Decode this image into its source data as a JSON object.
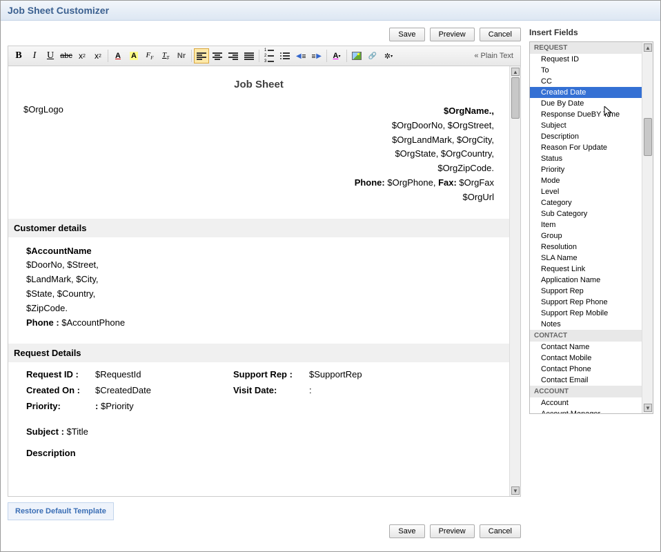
{
  "title": "Job Sheet Customizer",
  "buttons": {
    "save": "Save",
    "preview": "Preview",
    "cancel": "Cancel"
  },
  "toolbar": {
    "bold": "B",
    "italic": "I",
    "underline": "U",
    "strike": "abc",
    "sub": "x",
    "sup": "x",
    "fontcolor": "A",
    "bgcolor": "A",
    "fontface": "F",
    "fontsize": "T",
    "normal": "Nr",
    "plainText": "« Plain Text"
  },
  "editor": {
    "heading": "Job Sheet",
    "orgLogo": "$OrgLogo",
    "orgName": "$OrgName.,",
    "orgAddr1": "$OrgDoorNo, $OrgStreet,",
    "orgAddr2": "$OrgLandMark, $OrgCity,",
    "orgAddr3": "$OrgState, $OrgCountry,",
    "orgZip": "$OrgZipCode.",
    "orgPhonePrefix": "Phone: ",
    "orgPhone": "$OrgPhone, ",
    "orgFaxPrefix": "Fax: ",
    "orgFax": "$OrgFax",
    "orgUrl": "$OrgUrl",
    "custHeader": "Customer details",
    "accountName": "$AccountName",
    "custAddr1": "$DoorNo, $Street,",
    "custAddr2": "$LandMark, $City,",
    "custAddr3": "$State, $Country,",
    "custZip": "$ZipCode.",
    "custPhoneLabel": "Phone : ",
    "custPhone": "$AccountPhone",
    "reqHeader": "Request Details",
    "reqIdLbl": "Request ID :",
    "reqIdVal": "$RequestId",
    "supportRepLbl": "Support Rep :",
    "supportRepVal": "$SupportRep",
    "createdLbl": "Created On :",
    "createdVal": "$CreatedDate",
    "visitLbl": "Visit Date:",
    "visitVal": ":",
    "priorityLbl": "Priority:",
    "priorityColon": ":",
    "priorityVal": "$Priority",
    "subjectLbl": "Subject : ",
    "subjectVal": "$Title",
    "descLbl": "Description"
  },
  "restore": "Restore Default Template",
  "rightPanel": {
    "title": "Insert Fields",
    "groups": [
      {
        "name": "REQUEST",
        "items": [
          "Request ID",
          "To",
          "CC",
          "Created Date",
          "Due By Date",
          "Response DueBY Time",
          "Subject",
          "Description",
          "Reason For Update",
          "Status",
          "Priority",
          "Mode",
          "Level",
          "Category",
          "Sub Category",
          "Item",
          "Group",
          "Resolution",
          "SLA Name",
          "Request Link",
          "Application Name",
          "Support Rep",
          "Support Rep Phone",
          "Support Rep Mobile",
          "Notes"
        ]
      },
      {
        "name": "CONTACT",
        "items": [
          "Contact Name",
          "Contact Mobile",
          "Contact Phone",
          "Contact Email"
        ]
      },
      {
        "name": "ACCOUNT",
        "items": [
          "Account",
          "Account Manager"
        ]
      }
    ],
    "selected": "Created Date"
  }
}
